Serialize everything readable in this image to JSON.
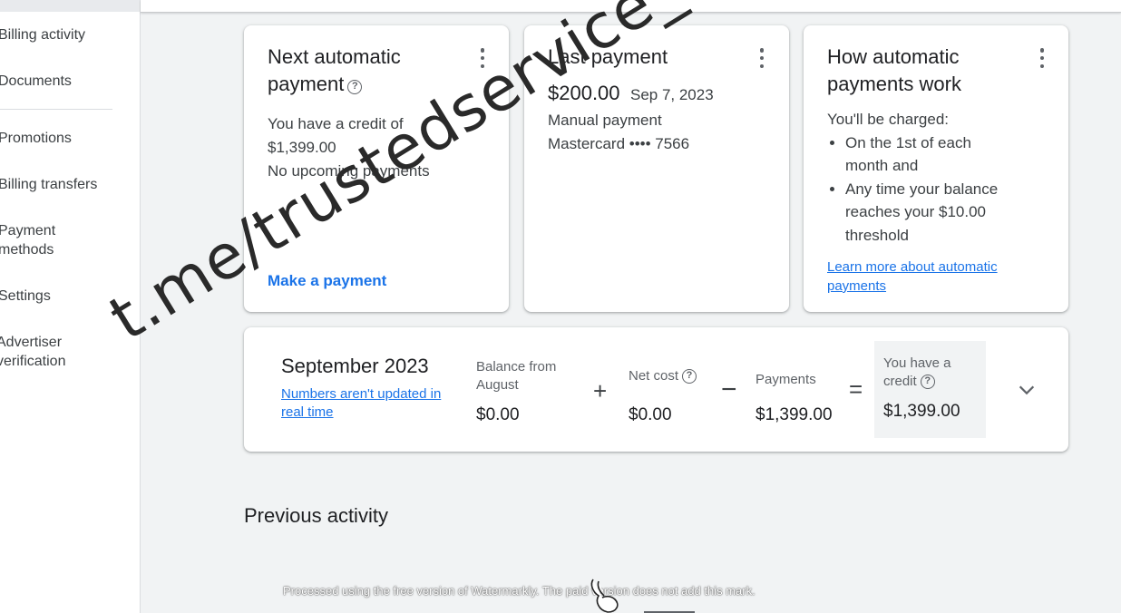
{
  "sidebar": {
    "items": [
      {
        "label": "Billing activity"
      },
      {
        "label": "Documents"
      },
      {
        "label": "Promotions"
      },
      {
        "label": "Billing transfers"
      },
      {
        "label": "Payment methods"
      },
      {
        "label": "Settings"
      },
      {
        "label": "Advertiser verification"
      }
    ]
  },
  "next_payment": {
    "title": "Next automatic payment",
    "line1": "You have a credit of",
    "credit_amount": "$1,399.00",
    "line3": "No upcoming payments",
    "action": "Make a payment"
  },
  "last_payment": {
    "title": "Last payment",
    "amount": "$200.00",
    "date": "Sep 7, 2023",
    "type": "Manual payment",
    "method": "Mastercard •••• 7566"
  },
  "how_it_works": {
    "title": "How automatic payments work",
    "intro": "You'll be charged:",
    "bullets": [
      "On the 1st of each month and",
      "Any time your balance reaches your $10.00 threshold"
    ],
    "link": "Learn more about automatic payments"
  },
  "summary": {
    "month": "September 2023",
    "note_link": "Numbers aren't updated in real time",
    "balance_label": "Balance from August",
    "balance_value": "$0.00",
    "net_cost_label": "Net cost",
    "net_cost_value": "$0.00",
    "payments_label": "Payments",
    "payments_value": "$1,399.00",
    "credit_label": "You have a credit",
    "credit_value": "$1,399.00",
    "op_plus": "+",
    "op_minus": "−",
    "op_equals": "="
  },
  "previous_activity": {
    "title": "Previous activity"
  },
  "overlay": {
    "watermark": "t.me/trustedservice_ads TG support",
    "footer": "Processed using the free version of Watermarkly. The paid version does not add this mark."
  }
}
